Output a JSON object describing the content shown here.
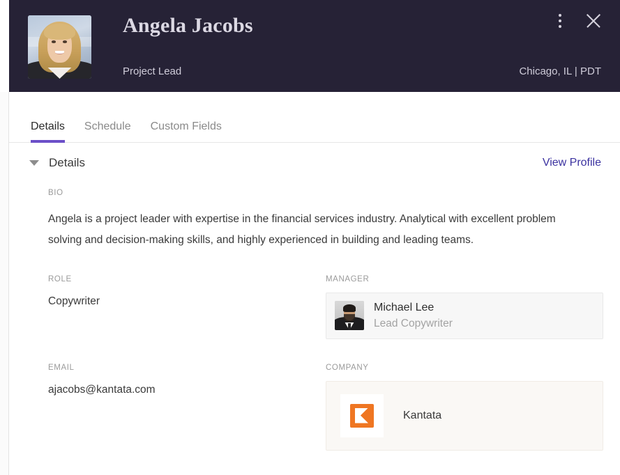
{
  "colors": {
    "header_bg": "#262236",
    "accent_purple": "#6b4fc8",
    "link_indigo": "#3b32a0",
    "kantata_orange": "#ef7622"
  },
  "header": {
    "name": "Angela Jacobs",
    "subtitle": "Project Lead",
    "location": "Chicago, IL | PDT",
    "avatar_alt": "Angela Jacobs profile photo",
    "menu_icon": "kebab-menu-icon",
    "close_icon": "close-icon"
  },
  "tabs": [
    {
      "label": "Details",
      "active": true
    },
    {
      "label": "Schedule",
      "active": false
    },
    {
      "label": "Custom Fields",
      "active": false
    }
  ],
  "section": {
    "title": "Details",
    "view_profile_label": "View Profile",
    "caret_icon": "caret-down-icon"
  },
  "fields": {
    "bio": {
      "label": "BIO",
      "value": "Angela is a project leader with expertise in the financial services industry. Analytical with excellent problem solving and decision-making skills, and highly experienced in building and leading teams."
    },
    "role": {
      "label": "ROLE",
      "value": "Copywriter"
    },
    "manager": {
      "label": "MANAGER",
      "name": "Michael Lee",
      "title": "Lead Copywriter",
      "avatar_alt": "Michael Lee profile photo"
    },
    "email": {
      "label": "EMAIL",
      "value": "ajacobs@kantata.com"
    },
    "company": {
      "label": "COMPANY",
      "name": "Kantata",
      "logo_alt": "kantata-logo-icon"
    }
  }
}
